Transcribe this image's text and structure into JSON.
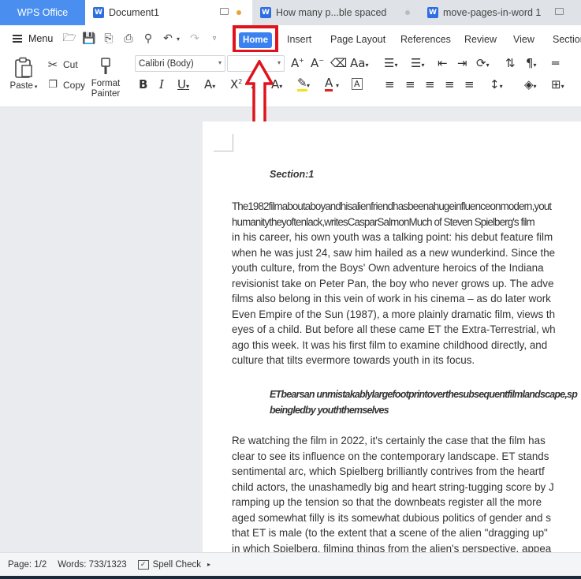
{
  "tabs": {
    "app": "WPS Office",
    "doc1": "Document1",
    "doc2": "How many p...ble spaced",
    "doc3": "move-pages-in-word 1"
  },
  "menu": {
    "menu_label": "Menu",
    "ribbon_tabs": [
      "Home",
      "Insert",
      "Page Layout",
      "References",
      "Review",
      "View",
      "Section"
    ]
  },
  "ribbon": {
    "paste": "Paste",
    "cut": "Cut",
    "copy": "Copy",
    "format_painter_1": "Format",
    "format_painter_2": "Painter",
    "font_name": "Calibri (Body)",
    "font_size": ""
  },
  "document": {
    "heading": "Section:1",
    "para1": [
      "The1982filmaboutaboyandhisalienfriendhasbeenahugeinfluenceonmodern,yout",
      "humanitytheyoftenlack,writesCasparSalmonMuch of Steven Spielberg's film",
      "in his career, his own youth was a talking point: his debut feature film",
      "when he was just 24, saw him hailed as a new wunderkind. Since the",
      "youth culture, from the Boys' Own adventure heroics of the Indiana",
      "revisionist take on Peter Pan, the boy who never grows up. The adve",
      "films also belong in this vein of work in his cinema – as do later work",
      "Even Empire of the Sun (1987), a more plainly dramatic film, views th",
      "eyes of a child. But before all these came ET the Extra-Terrestrial, wh",
      "ago this week. It was his first film to examine childhood directly, and",
      "culture that tilts evermore towards youth in its focus."
    ],
    "quote": [
      "ETbearsan unmistakablylargefootprintoverthesubsequentfilmlandscape,sp",
      "beingledby youththemselves"
    ],
    "para2": [
      "Re watching the film in 2022, it's certainly the case that the film has",
      "clear to see its influence on the contemporary landscape. ET stands",
      "sentimental arc, which Spielberg brilliantly contrives from the heartf",
      "child actors, the unashamedly big and heart string-tugging score by J",
      "ramping up the tension so that the downbeats register all the more",
      "aged somewhat filly is its somewhat dubious politics of gender and s",
      "that ET is male (to the extent that a scene of the alien \"dragging up\"",
      "in which Spielberg, filming things from the alien's perspective, appea"
    ]
  },
  "status": {
    "page": "Page: 1/2",
    "words": "Words: 733/1323",
    "spell_check": "Spell Check"
  },
  "colors": {
    "accent": "#3b82f0",
    "highlight_red": "#e0131c"
  }
}
